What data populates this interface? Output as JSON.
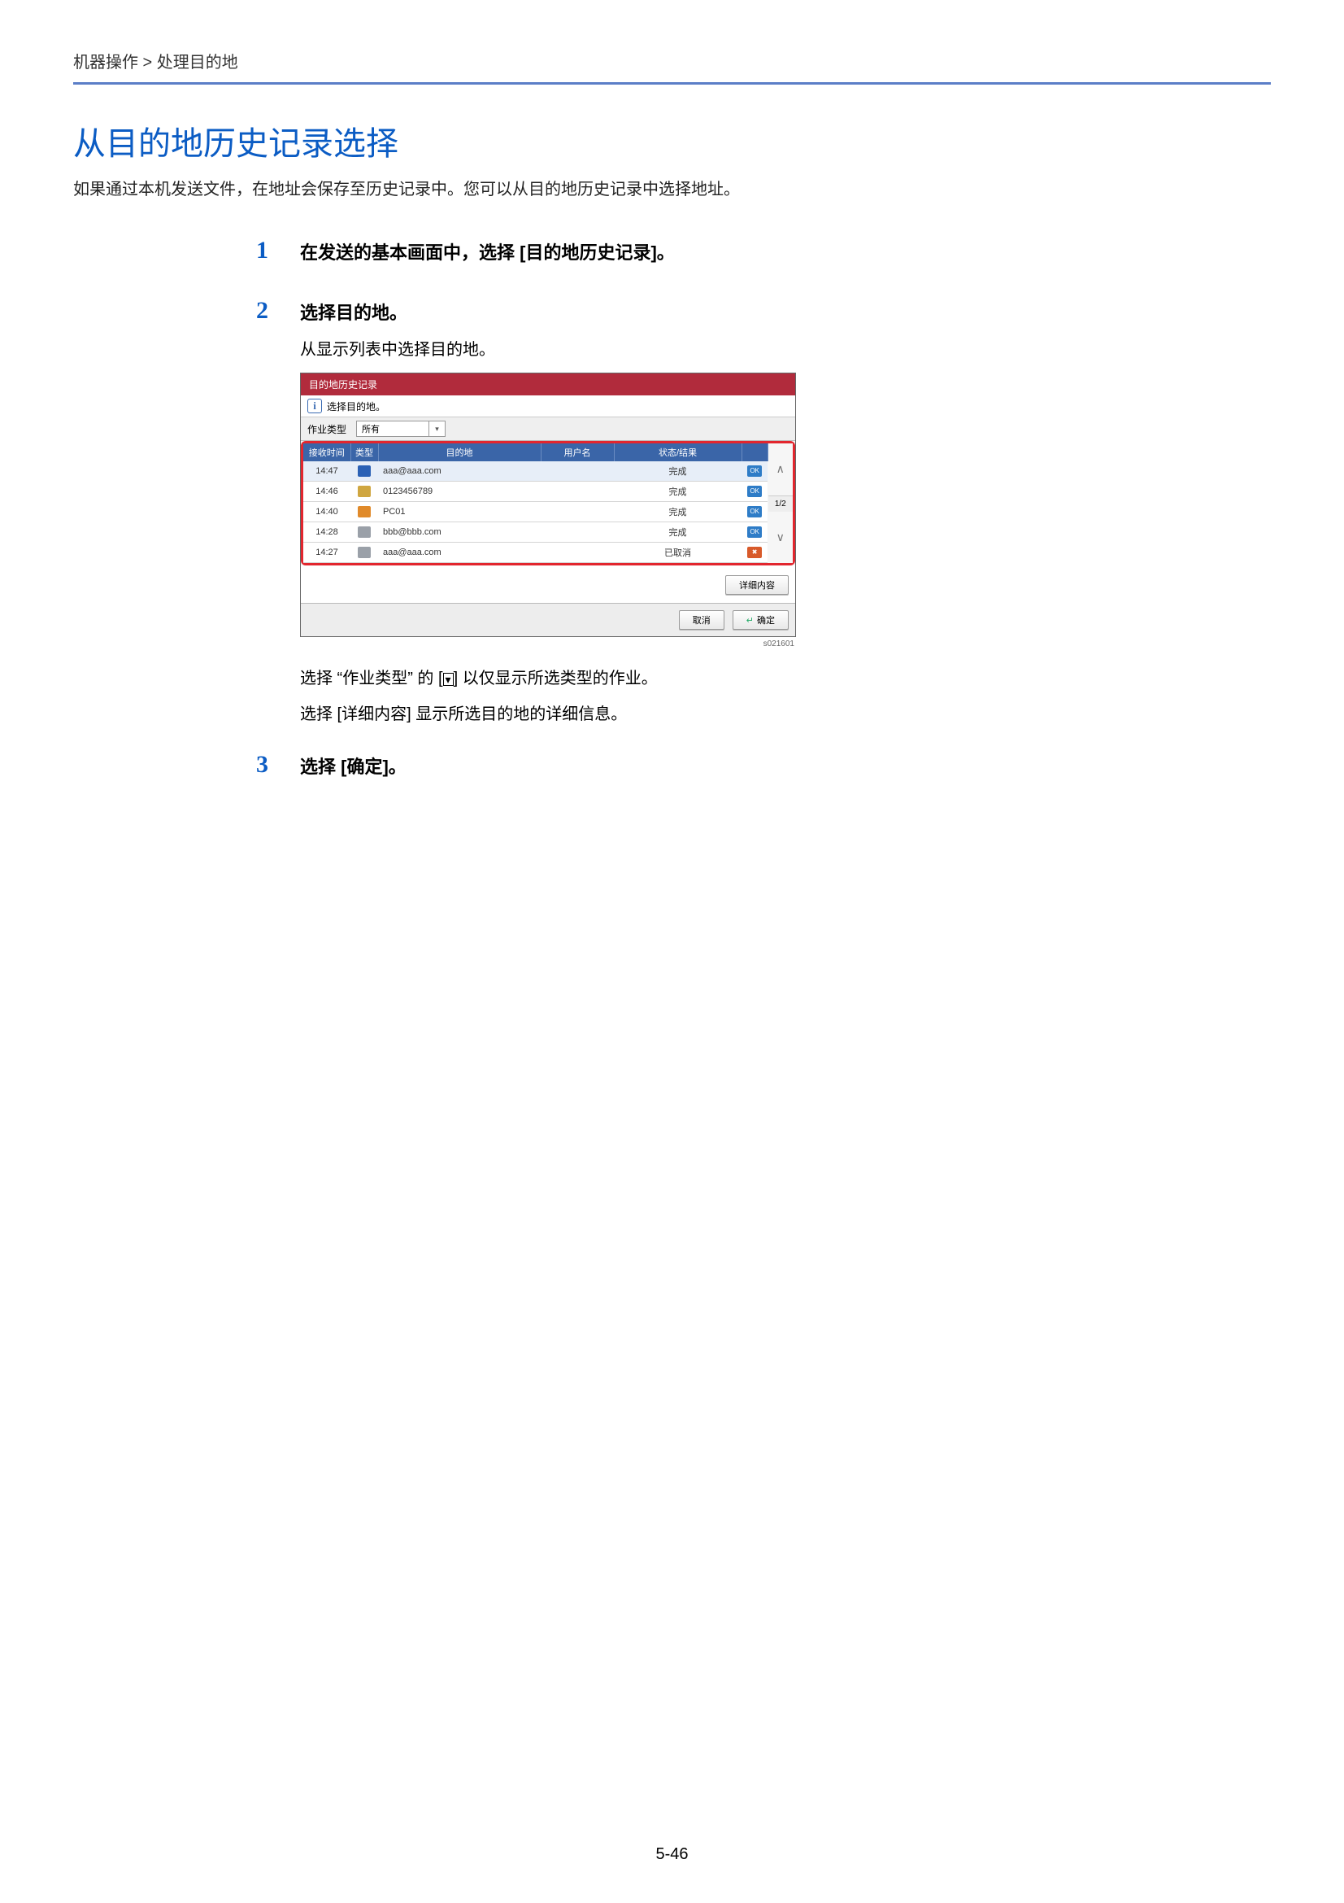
{
  "breadcrumb": "机器操作 > 处理目的地",
  "h1": "从目的地历史记录选择",
  "intro": "如果通过本机发送文件，在地址会保存至历史记录中。您可以从目的地历史记录中选择地址。",
  "steps": {
    "s1": {
      "num": "1",
      "title": "在发送的基本画面中，选择 [目的地历史记录]。"
    },
    "s2": {
      "num": "2",
      "title": "选择目的地。",
      "desc": "从显示列表中选择目的地。",
      "after_a": "选择 “作业类型” 的 [",
      "after_b": "] 以仅显示所选类型的作业。",
      "after2": "选择 [详细内容] 显示所选目的地的详细信息。"
    },
    "s3": {
      "num": "3",
      "title": "选择 [确定]。"
    }
  },
  "shot": {
    "titlebar": "目的地历史记录",
    "info": "选择目的地。",
    "filter_label": "作业类型",
    "filter_value": "所有",
    "th": {
      "time": "接收时间",
      "type": "类型",
      "dest": "目的地",
      "user": "用户名",
      "status": "状态/结果"
    },
    "rows": [
      {
        "time": "14:47",
        "icon": "mail",
        "dest": "aaa@aaa.com",
        "user": "",
        "status": "完成",
        "ok": true
      },
      {
        "time": "14:46",
        "icon": "fax",
        "dest": "0123456789",
        "user": "",
        "status": "完成",
        "ok": true
      },
      {
        "time": "14:40",
        "icon": "printer",
        "dest": "PC01",
        "user": "",
        "status": "完成",
        "ok": true
      },
      {
        "time": "14:28",
        "icon": "pc",
        "dest": "bbb@bbb.com",
        "user": "",
        "status": "完成",
        "ok": true
      },
      {
        "time": "14:27",
        "icon": "pc",
        "dest": "aaa@aaa.com",
        "user": "",
        "status": "已取消",
        "ok": false
      }
    ],
    "page_indicator": "1/2",
    "detail_btn": "详细内容",
    "cancel_btn": "取消",
    "ok_btn": "确定",
    "id": "s021601"
  },
  "chev_glyph": "▾",
  "page_num": "5-46"
}
